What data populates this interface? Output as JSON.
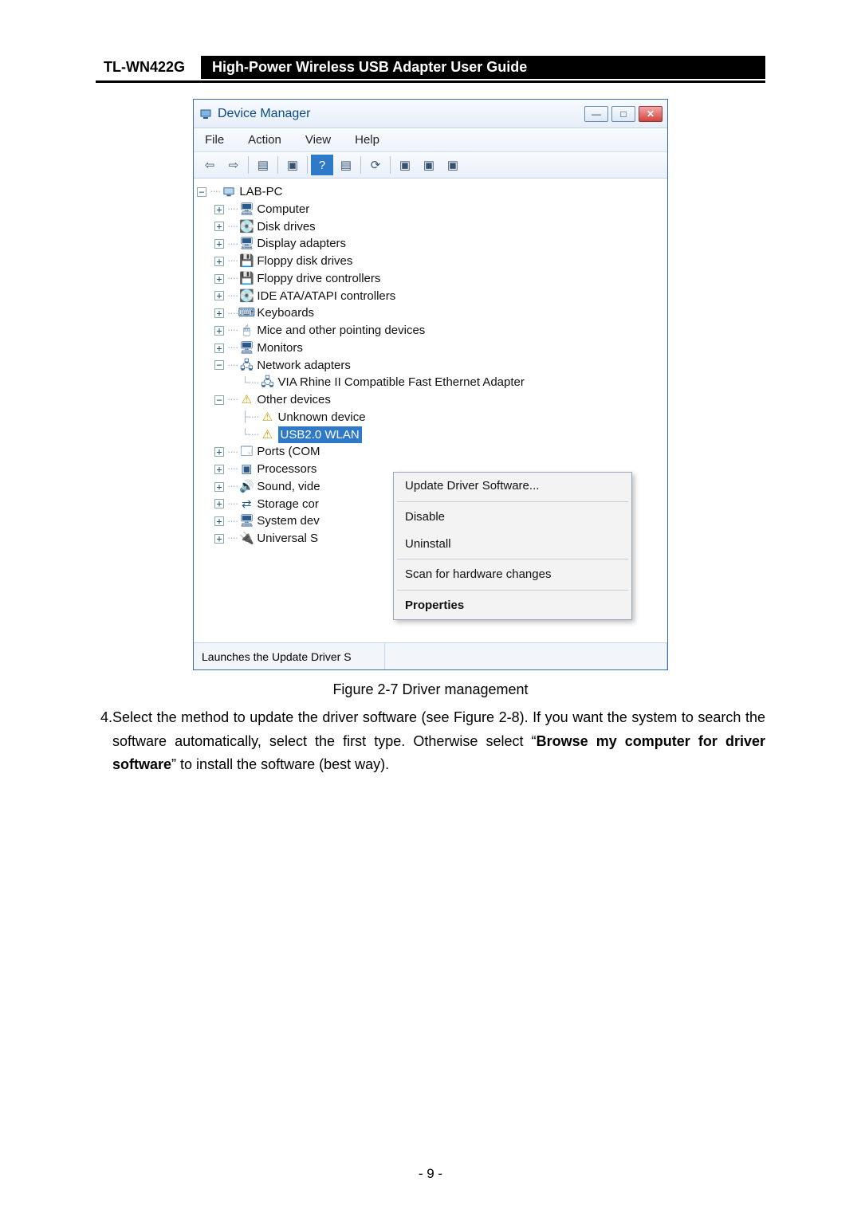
{
  "header": {
    "model": "TL-WN422G",
    "title": "High-Power Wireless USB Adapter User Guide"
  },
  "window": {
    "title": "Device Manager",
    "menubar": [
      "File",
      "Action",
      "View",
      "Help"
    ],
    "status": "Launches the Update Driver S"
  },
  "tree": {
    "root": "LAB-PC",
    "nodes": [
      "Computer",
      "Disk drives",
      "Display adapters",
      "Floppy disk drives",
      "Floppy drive controllers",
      "IDE ATA/ATAPI controllers",
      "Keyboards",
      "Mice and other pointing devices",
      "Monitors",
      "Network adapters",
      "Other devices",
      "Ports (COM",
      "Processors",
      "Sound, vide",
      "Storage cor",
      "System dev",
      "Universal S"
    ],
    "network_child": "VIA Rhine II Compatible Fast Ethernet Adapter",
    "other_children": [
      "Unknown device",
      "USB2.0 WLAN"
    ]
  },
  "context_menu": {
    "items": [
      "Update Driver Software...",
      "Disable",
      "Uninstall",
      "Scan for hardware changes",
      "Properties"
    ]
  },
  "caption": "Figure 2-7 Driver management",
  "step": {
    "num": "4.",
    "text_pre": "Select the method to update the driver software (see Figure 2-8). If you want the system to search the software automatically, select the first type. Otherwise select “",
    "bold": "Browse my computer for driver software",
    "text_post": "” to install the software (best way)."
  },
  "page_number": "- 9 -"
}
